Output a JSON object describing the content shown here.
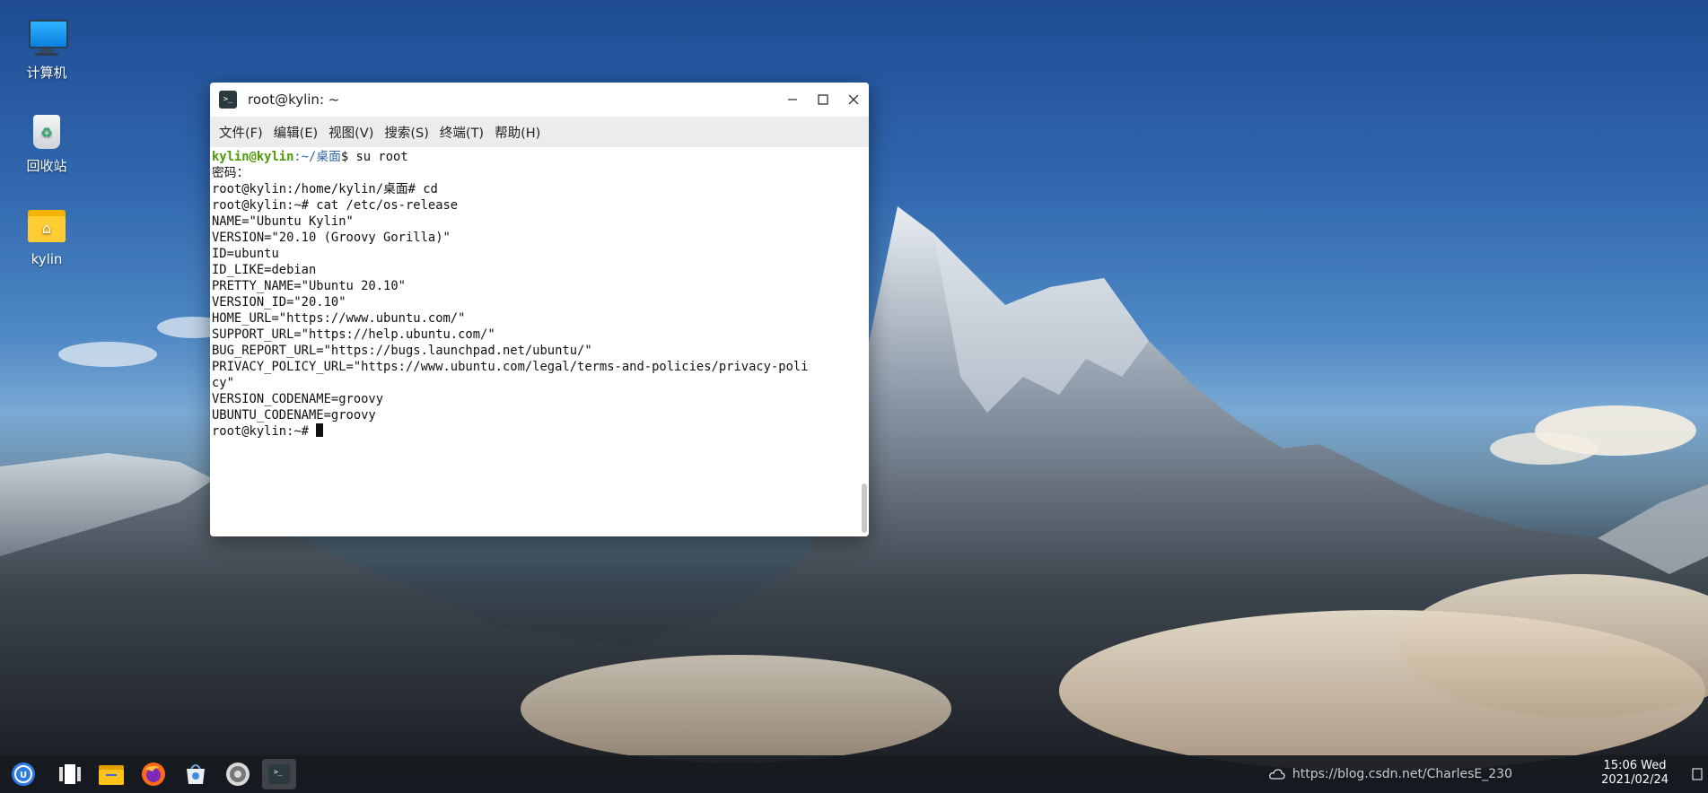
{
  "desktop": {
    "icons": [
      {
        "label": "计算机",
        "icon": "computer-icon"
      },
      {
        "label": "回收站",
        "icon": "trash-icon"
      },
      {
        "label": "kylin",
        "icon": "home-folder-icon"
      }
    ]
  },
  "terminal": {
    "title": "root@kylin: ~",
    "menu": [
      "文件(F)",
      "编辑(E)",
      "视图(V)",
      "搜索(S)",
      "终端(T)",
      "帮助(H)"
    ],
    "prompt_user": "kylin@kylin",
    "prompt_path": ":~/桌面",
    "first_command": "$ su root",
    "lines": [
      "密码：",
      "root@kylin:/home/kylin/桌面# cd",
      "root@kylin:~# cat /etc/os-release",
      "NAME=\"Ubuntu Kylin\"",
      "VERSION=\"20.10 (Groovy Gorilla)\"",
      "ID=ubuntu",
      "ID_LIKE=debian",
      "PRETTY_NAME=\"Ubuntu 20.10\"",
      "VERSION_ID=\"20.10\"",
      "HOME_URL=\"https://www.ubuntu.com/\"",
      "SUPPORT_URL=\"https://help.ubuntu.com/\"",
      "BUG_REPORT_URL=\"https://bugs.launchpad.net/ubuntu/\"",
      "PRIVACY_POLICY_URL=\"https://www.ubuntu.com/legal/terms-and-policies/privacy-poli",
      "cy\"",
      "VERSION_CODENAME=groovy",
      "UBUNTU_CODENAME=groovy"
    ],
    "final_prompt": "root@kylin:~# "
  },
  "taskbar": {
    "apps": [
      {
        "name": "start-menu-icon",
        "active": false
      },
      {
        "name": "multitask-view-icon",
        "active": false
      },
      {
        "name": "file-manager-icon",
        "active": false
      },
      {
        "name": "firefox-icon",
        "active": false
      },
      {
        "name": "software-store-icon",
        "active": false
      },
      {
        "name": "settings-icon",
        "active": false
      },
      {
        "name": "terminal-icon",
        "active": true
      }
    ],
    "watermark": "https://blog.csdn.net/CharlesE_230",
    "clock_time": "15:06 Wed",
    "clock_date": "2021/02/24"
  },
  "colors": {
    "prompt_user": "#4e9a06",
    "prompt_path": "#3465a4",
    "taskbar": "#161a20"
  }
}
